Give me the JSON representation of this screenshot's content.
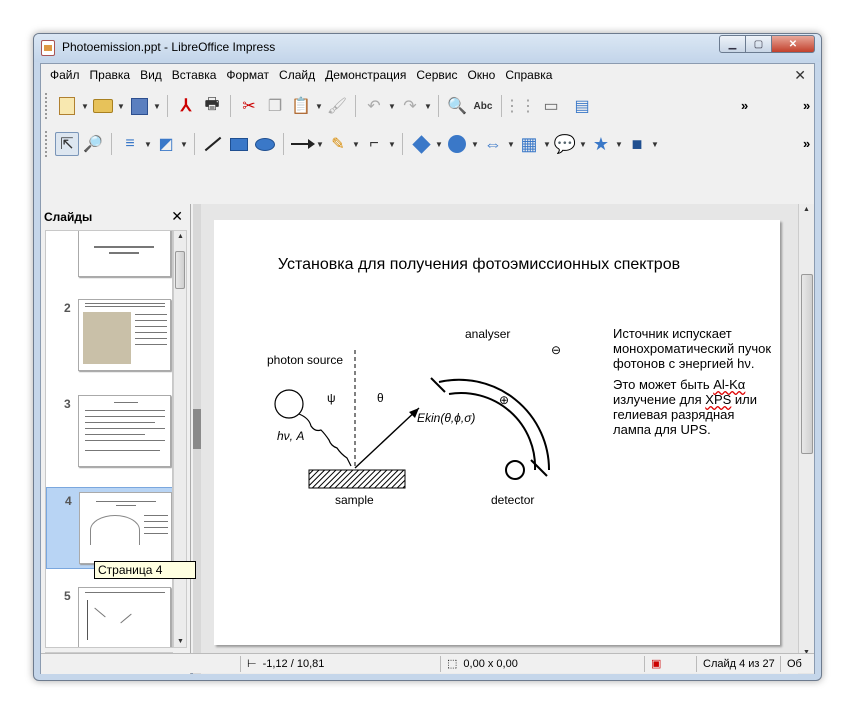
{
  "window": {
    "title": "Photoemission.ppt - LibreOffice Impress"
  },
  "menu": [
    "Файл",
    "Правка",
    "Вид",
    "Вставка",
    "Формат",
    "Слайд",
    "Демонстрация",
    "Сервис",
    "Окно",
    "Справка"
  ],
  "slides_panel": {
    "title": "Слайды",
    "items": [
      {
        "number": "2"
      },
      {
        "number": "3"
      },
      {
        "number": "4"
      },
      {
        "number": "5"
      }
    ],
    "tooltip": "Страница 4"
  },
  "slide": {
    "title": "Установка для получения фотоэмиссионных спектров",
    "text_para1": "Источник испускает монохроматический пучок фотонов с энергией hν.",
    "text_para2_prefix": "Это может быть ",
    "text_para2_alk": "Al-Kα",
    "text_para2_mid": " излучение для ",
    "text_para2_xps": "XPS",
    "text_para2_suffix": " или гелиевая разрядная лампа для UPS.",
    "diagram": {
      "photon_source": "photon source",
      "analyser": "analyser",
      "sample": "sample",
      "detector": "detector",
      "psi": "ψ",
      "theta": "θ",
      "hv_a": "hν, A",
      "ekin": "Ekin(θ,ϕ,σ)",
      "minus": "⊖",
      "plus": "⊕"
    }
  },
  "status": {
    "position": "-1,12 / 10,81",
    "size": "0,00 x 0,00",
    "slide_info": "Слайд 4 из 27",
    "layout": "Об"
  },
  "icons": {
    "toolbar1": [
      "new-icon",
      "open-icon",
      "save-icon",
      "export-pdf-icon",
      "print-icon",
      "cut-icon",
      "copy-icon",
      "paste-icon",
      "clone-formatting-icon",
      "undo-icon",
      "redo-icon",
      "find-replace-icon",
      "spellcheck-icon",
      "grid-icon",
      "display-views-icon",
      "slide-icon",
      "more-icon"
    ],
    "toolbar2": [
      "select-icon",
      "zoom-icon",
      "line-color-icon",
      "fill-color-icon",
      "line-icon",
      "rectangle-icon",
      "ellipse-icon",
      "arrow-icon",
      "freeform-icon",
      "connector-icon",
      "basic-shapes-icon",
      "symbol-shapes-icon",
      "block-arrows-icon",
      "flowchart-icon",
      "callout-icon",
      "stars-icon",
      "3d-objects-icon",
      "more-icon"
    ]
  }
}
